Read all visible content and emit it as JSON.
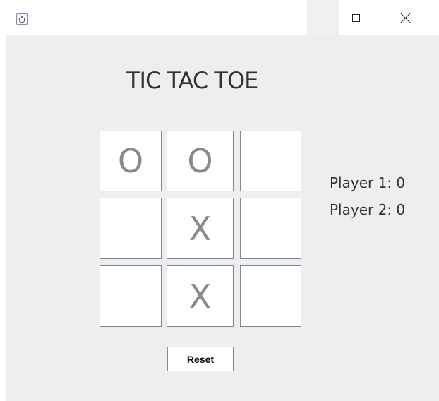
{
  "window": {
    "controls": {
      "minimize_icon": "minimize-icon",
      "maximize_icon": "maximize-icon",
      "close_icon": "close-icon"
    },
    "app_icon": "java-cup-icon"
  },
  "game": {
    "title": "TIC TAC TOE",
    "board": [
      "O",
      "O",
      "",
      "",
      "X",
      "",
      "",
      "X",
      ""
    ],
    "player1": "Player 1: 0",
    "player2": "Player 2: 0",
    "reset_label": "Reset"
  },
  "colors": {
    "window_bg": "#eeeeee",
    "cell_bg": "#ffffff",
    "cell_border": "#7a8a9a",
    "mark_color": "#8a8a8a"
  }
}
